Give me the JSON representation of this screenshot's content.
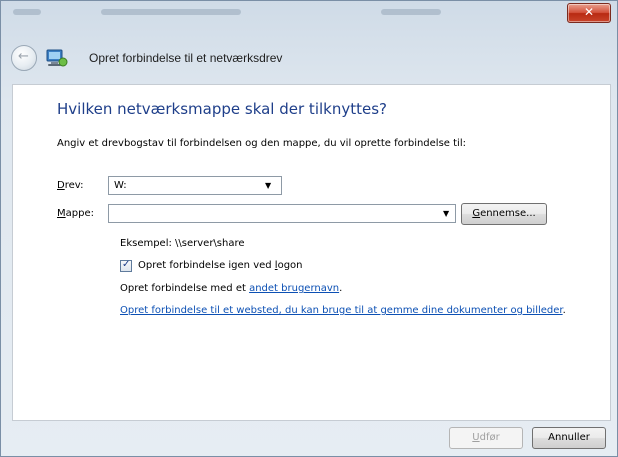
{
  "window": {
    "close_label": "✕",
    "nav_title": "Opret forbindelse til et netværksdrev"
  },
  "content": {
    "heading": "Hvilken netværksmappe skal der tilknyttes?",
    "instruction": "Angiv et drevbogstav til forbindelsen og den mappe, du vil oprette forbindelse til:",
    "drive": {
      "label_accel": "D",
      "label_rest": "rev:",
      "value": "W:"
    },
    "folder": {
      "label_accel": "M",
      "label_rest": "appe:",
      "value": ""
    },
    "browse": {
      "accel": "G",
      "rest": "ennemse..."
    },
    "example": "Eksempel: \\\\server\\share",
    "reconnect": {
      "checked": true,
      "prefix": "Opret forbindelse igen ved ",
      "accel": "l",
      "suffix": "ogon"
    },
    "other_user": {
      "prefix": "Opret forbindelse med et ",
      "link": "andet brugernavn",
      "suffix": "."
    },
    "website_link": {
      "link": "Opret forbindelse til et websted, du kan bruge til at gemme dine dokumenter og billeder",
      "suffix": "."
    }
  },
  "buttons": {
    "finish": {
      "accel": "U",
      "rest": "dfør"
    },
    "cancel": "Annuller"
  }
}
